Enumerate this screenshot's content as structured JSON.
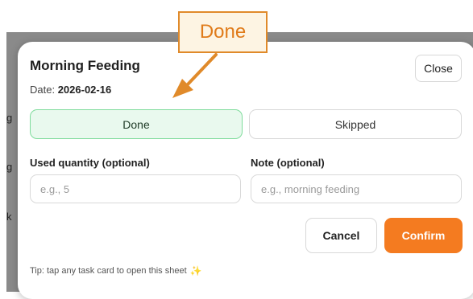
{
  "background_rows": [
    "g",
    "g",
    "k"
  ],
  "callout": {
    "label": "Done",
    "color": "#e07b1a"
  },
  "sheet": {
    "title": "Morning Feeding",
    "date_label": "Date:",
    "date_value": "2026-02-16",
    "close_label": "Close"
  },
  "status_options": {
    "done_label": "Done",
    "skipped_label": "Skipped",
    "selected": "Done"
  },
  "fields": {
    "quantity_label": "Used quantity (optional)",
    "quantity_placeholder": "e.g., 5",
    "quantity_value": "",
    "note_label": "Note (optional)",
    "note_placeholder": "e.g., morning feeding",
    "note_value": ""
  },
  "actions": {
    "cancel_label": "Cancel",
    "confirm_label": "Confirm",
    "confirm_color": "#f47b20"
  },
  "tip": {
    "text": "Tip: tap any task card to open this sheet",
    "icon": "sparkle-icon"
  }
}
